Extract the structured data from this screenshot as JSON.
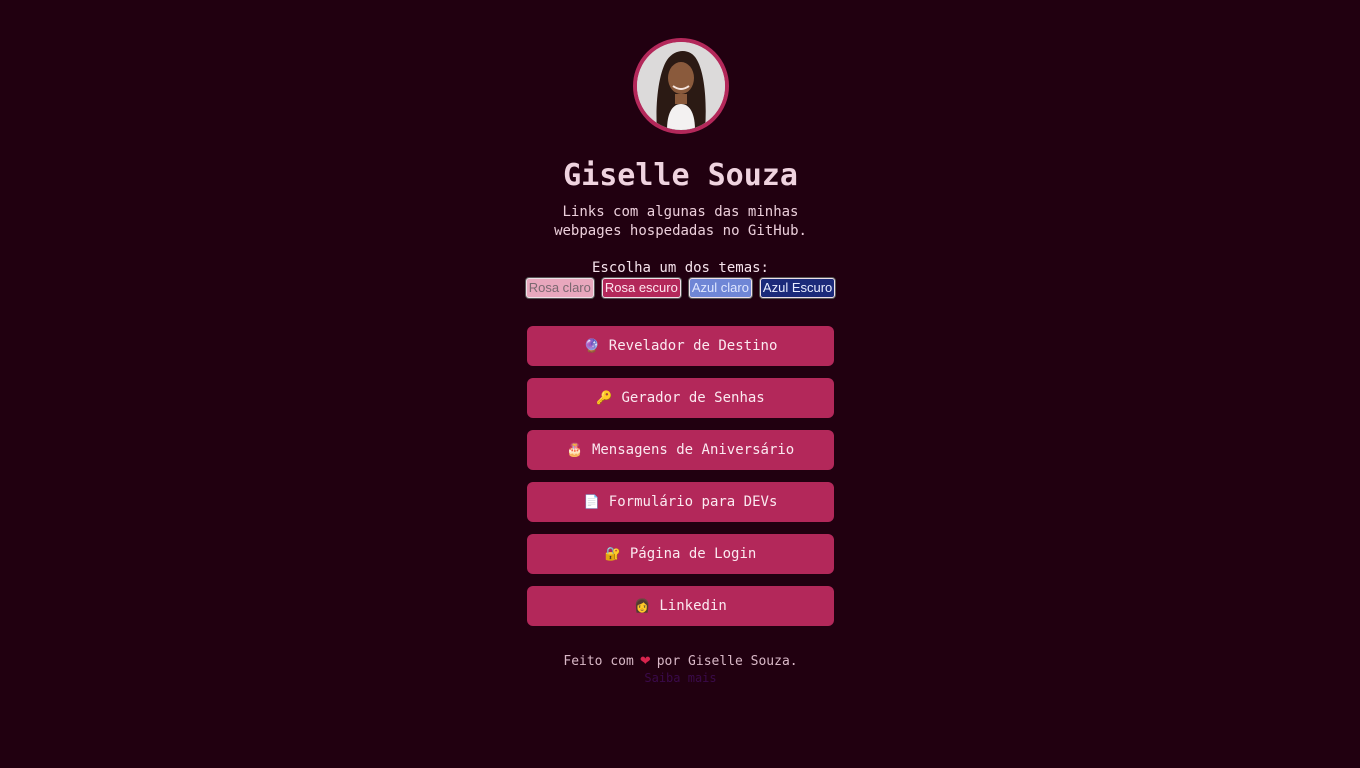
{
  "profile": {
    "name": "Giselle Souza",
    "bio": "Links com algunas das minhas webpages hospedadas no GitHub."
  },
  "themes": {
    "title": "Escolha um dos temas:",
    "options": [
      "Rosa claro",
      "Rosa escuro",
      "Azul claro",
      "Azul Escuro"
    ]
  },
  "links": [
    {
      "icon": "crystal-ball-icon",
      "emoji": "🔮",
      "label": "Revelador de Destino"
    },
    {
      "icon": "key-icon",
      "emoji": "🔑",
      "label": "Gerador de Senhas"
    },
    {
      "icon": "cake-icon",
      "emoji": "🎂",
      "label": "Mensagens de Aniversário"
    },
    {
      "icon": "document-icon",
      "emoji": "📄",
      "label": "Formulário para DEVs"
    },
    {
      "icon": "lock-icon",
      "emoji": "🔐",
      "label": "Página de Login"
    },
    {
      "icon": "woman-icon",
      "emoji": "👩",
      "label": "Linkedin"
    }
  ],
  "footer": {
    "prefix": "Feito com",
    "heart": "❤",
    "suffix": "por Giselle Souza.",
    "more": "Saiba mais"
  },
  "colors": {
    "background": "#210010",
    "accent": "#b3285a"
  }
}
